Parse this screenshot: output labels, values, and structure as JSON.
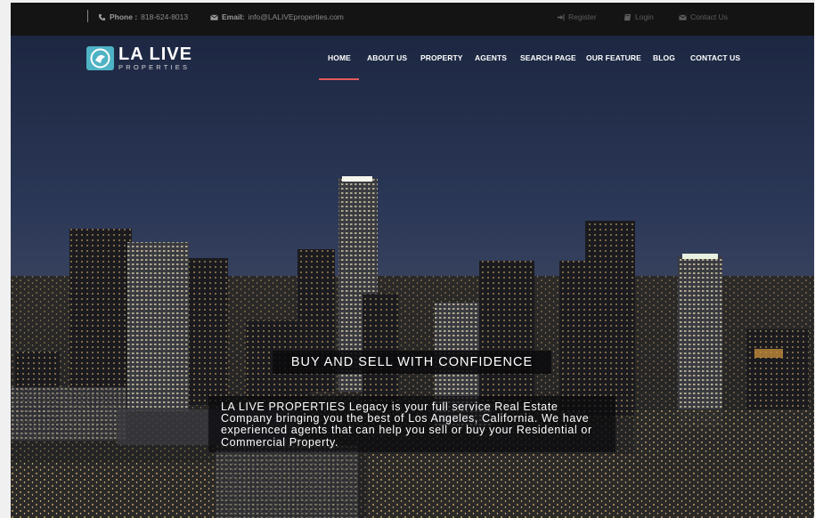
{
  "topbar": {
    "phone_label": "Phone :",
    "phone_value": "818-624-8013",
    "email_label": "Email:",
    "email_value": "info@LALIVEproperties.com",
    "register": "Register",
    "login": "Login",
    "contact": "Contact Us"
  },
  "logo": {
    "title": "LA LIVE",
    "subtitle": "PROPERTIES"
  },
  "nav": {
    "items": [
      "HOME",
      "ABOUT US",
      "PROPERTY",
      "AGENTS",
      "SEARCH PAGE",
      "OUR FEATURE",
      "BLOG",
      "CONTACT US"
    ],
    "active": "HOME"
  },
  "hero": {
    "headline": "BUY AND SELL WITH CONFIDENCE",
    "description": "LA LIVE PROPERTIES Legacy is your full service Real Estate Company bringing you the best of Los Angeles, California. We have experienced agents that can help you sell or buy your Residential or Commercial Property."
  },
  "colors": {
    "accent": "#e05a5a",
    "logo_teal": "#4eb3c4",
    "topbar_bg": "#141414"
  }
}
